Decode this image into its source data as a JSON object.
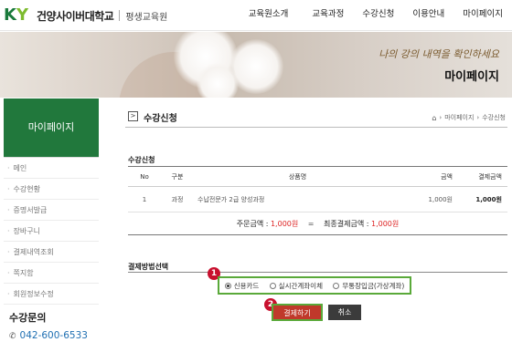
{
  "header": {
    "logo_text": "KY",
    "school_name": "건양사이버대학교",
    "sub_name": "평생교육원",
    "nav": [
      "교육원소개",
      "교육과정",
      "수강신청",
      "이용안내",
      "마이페이지"
    ]
  },
  "banner": {
    "slogan": "나의 강의 내역을 확인하세요",
    "title": "마이페이지"
  },
  "sidebar": {
    "heading": "마이페이지",
    "items": [
      "메인",
      "수강현황",
      "증명서발급",
      "장바구니",
      "결제내역조회",
      "쪽지함",
      "회원정보수정"
    ],
    "contact_label": "수강문의",
    "phone": "042-600-6533"
  },
  "page": {
    "title": "수강신청",
    "breadcrumb": [
      "마이페이지",
      "수강신청"
    ]
  },
  "order": {
    "section_title": "수강신청",
    "columns": [
      "No",
      "구분",
      "상품명",
      "금액",
      "결제금액"
    ],
    "rows": [
      {
        "no": "1",
        "kind": "과정",
        "name": "수납전문가 2급 양성과정",
        "price": "1,000원",
        "total": "1,000원"
      }
    ],
    "summary": {
      "order_label": "주문금액 : ",
      "order_amount": "1,000원",
      "equals": "=",
      "final_label": "최종결제금액 : ",
      "final_amount": "1,000원"
    }
  },
  "payment": {
    "section_title": "결제방법선택",
    "options": [
      "신용카드",
      "실시간계좌이체",
      "무통장입금(가상계좌)"
    ],
    "selected_index": 0,
    "step1": "1",
    "step2": "2",
    "pay_button": "결제하기",
    "cancel_button": "취소"
  },
  "colors": {
    "brand_green": "#21783c",
    "highlight_green": "#5aa93a",
    "step_badge": "#c8102e",
    "pay_button": "#c0392b",
    "amount_red": "#dd2222"
  }
}
